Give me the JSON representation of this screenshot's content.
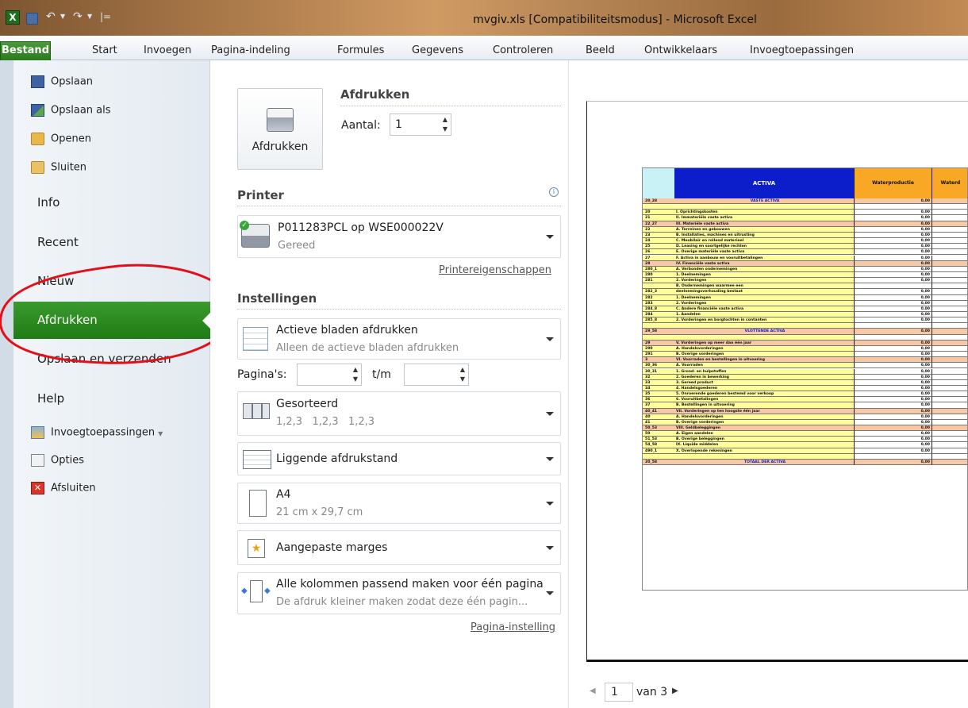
{
  "window": {
    "title": "mvgiv.xls [Compatibiliteitsmodus] - Microsoft Excel"
  },
  "ribbon": {
    "file_tab": "Bestand",
    "tabs": [
      "Start",
      "Invoegen",
      "Pagina-indeling",
      "Formules",
      "Gegevens",
      "Controleren",
      "Beeld",
      "Ontwikkelaars",
      "Invoegtoepassingen"
    ]
  },
  "backstage": {
    "items": {
      "save": "Opslaan",
      "save_as": "Opslaan als",
      "open": "Openen",
      "close": "Sluiten",
      "info": "Info",
      "recent": "Recent",
      "new": "Nieuw",
      "print": "Afdrukken",
      "save_send": "Opslaan en verzenden",
      "help": "Help",
      "addins": "Invoegtoepassingen",
      "options": "Opties",
      "exit": "Afsluiten"
    }
  },
  "print": {
    "heading": "Afdrukken",
    "button_label": "Afdrukken",
    "copies_label": "Aantal:",
    "copies_value": "1",
    "printer_heading": "Printer",
    "printer_name": "P011283PCL op WSE000022V",
    "printer_status": "Gereed",
    "printer_props_link": "Printereigenschappen",
    "settings_heading": "Instellingen",
    "settings": [
      {
        "title": "Actieve bladen afdrukken",
        "sub": "Alleen de actieve bladen afdrukken"
      },
      {
        "title": "Gesorteerd",
        "sub": "1,2,3   1,2,3   1,2,3"
      },
      {
        "title": "Liggende afdrukstand",
        "sub": ""
      },
      {
        "title": "A4",
        "sub": "21 cm x 29,7 cm"
      },
      {
        "title": "Aangepaste marges",
        "sub": ""
      },
      {
        "title": "Alle kolommen passend maken voor één pagina",
        "sub": "De afdruk kleiner maken zodat deze één pagin..."
      }
    ],
    "pages_label": "Pagina's:",
    "pages_to_label": "t/m",
    "page_setup_link": "Pagina-instelling"
  },
  "preview": {
    "header": {
      "code": "",
      "title": "ACTIVA",
      "col1": "Waterproductie",
      "col2": "Waterd"
    },
    "rows": [
      {
        "code": "20_28",
        "label": "VASTE ACTIVA",
        "value": "0,00",
        "hl": true,
        "tot": true
      },
      {
        "code": "",
        "label": "",
        "value": "",
        "hl": false,
        "tot": false
      },
      {
        "code": "20",
        "label": "I. Oprichtingskosten",
        "value": "0,00",
        "hl": false,
        "tot": false
      },
      {
        "code": "21",
        "label": "II. Immateriële vaste activa",
        "value": "0,00",
        "hl": false,
        "tot": false
      },
      {
        "code": "22_27",
        "label": "III. Materiële vaste activa",
        "value": "0,00",
        "hl": true,
        "tot": false
      },
      {
        "code": "22",
        "label": "A. Terreinen en gebouwen",
        "value": "0,00",
        "hl": false,
        "tot": false
      },
      {
        "code": "23",
        "label": "B. Installaties, machines en uitrusting",
        "value": "0,00",
        "hl": false,
        "tot": false
      },
      {
        "code": "24",
        "label": "C. Meubilair en rollend materieel",
        "value": "0,00",
        "hl": false,
        "tot": false
      },
      {
        "code": "25",
        "label": "D. Leasing en soortgelijke rechten",
        "value": "0,00",
        "hl": false,
        "tot": false
      },
      {
        "code": "26",
        "label": "E. Overige materiële vaste activa",
        "value": "0,00",
        "hl": false,
        "tot": false
      },
      {
        "code": "27",
        "label": "F. Activa in aanbouw en vooruitbetalingen",
        "value": "0,00",
        "hl": false,
        "tot": false
      },
      {
        "code": "28",
        "label": "IV. Financiële vaste activa",
        "value": "0,00",
        "hl": true,
        "tot": false
      },
      {
        "code": "280_1",
        "label": "A. Verbonden ondernemingen",
        "value": "0,00",
        "hl": false,
        "tot": false
      },
      {
        "code": "280",
        "label": "1. Deelnemingen",
        "value": "0,00",
        "hl": false,
        "tot": false
      },
      {
        "code": "281",
        "label": "2. Vorderingen",
        "value": "0,00",
        "hl": false,
        "tot": false
      },
      {
        "code": "",
        "label": "B. Ondernemingen waarmee een",
        "value": "",
        "hl": false,
        "tot": false
      },
      {
        "code": "282_3",
        "label": "deelnemingsverhouding bestaat",
        "value": "0,00",
        "hl": false,
        "tot": false
      },
      {
        "code": "282",
        "label": "1. Deelnemingen",
        "value": "0,00",
        "hl": false,
        "tot": false
      },
      {
        "code": "283",
        "label": "2. Vorderingen",
        "value": "0,00",
        "hl": false,
        "tot": false
      },
      {
        "code": "284_8",
        "label": "C. Andere financiële vaste activa",
        "value": "0,00",
        "hl": false,
        "tot": false
      },
      {
        "code": "284",
        "label": "1. Aandelen",
        "value": "0,00",
        "hl": false,
        "tot": false
      },
      {
        "code": "285_8",
        "label": "2. Vorderingen en borgtochten in contanten",
        "value": "0,00",
        "hl": false,
        "tot": false
      },
      {
        "code": "",
        "label": "",
        "value": "",
        "hl": false,
        "tot": false
      },
      {
        "code": "29_58",
        "label": "VLOTTENDE ACTIVA",
        "value": "0,00",
        "hl": true,
        "tot": true
      },
      {
        "code": "",
        "label": "",
        "value": "",
        "hl": false,
        "tot": false
      },
      {
        "code": "29",
        "label": "V. Vorderingen op meer dan één jaar",
        "value": "0,00",
        "hl": true,
        "tot": false
      },
      {
        "code": "290",
        "label": "A. Handelsvorderingen",
        "value": "0,00",
        "hl": false,
        "tot": false
      },
      {
        "code": "291",
        "label": "B. Overige vorderingen",
        "value": "0,00",
        "hl": false,
        "tot": false
      },
      {
        "code": "3",
        "label": "VI. Voorraden en bestellingen in uitvoering",
        "value": "0,00",
        "hl": true,
        "tot": false
      },
      {
        "code": "30_36",
        "label": "A. Voorraden",
        "value": "0,00",
        "hl": false,
        "tot": false
      },
      {
        "code": "30_31",
        "label": "1. Grond- en hulpstoffen",
        "value": "0,00",
        "hl": false,
        "tot": false
      },
      {
        "code": "32",
        "label": "2. Goederen in bewerking",
        "value": "0,00",
        "hl": false,
        "tot": false
      },
      {
        "code": "33",
        "label": "3. Gereed product",
        "value": "0,00",
        "hl": false,
        "tot": false
      },
      {
        "code": "34",
        "label": "4. Handelsgoederen",
        "value": "0,00",
        "hl": false,
        "tot": false
      },
      {
        "code": "35",
        "label": "5. Onroerende goederen bestemd voor verkoop",
        "value": "0,00",
        "hl": false,
        "tot": false
      },
      {
        "code": "36",
        "label": "6. Vooruitbetalingen",
        "value": "0,00",
        "hl": false,
        "tot": false
      },
      {
        "code": "37",
        "label": "B. Bestellingen in uitvoering",
        "value": "0,00",
        "hl": false,
        "tot": false
      },
      {
        "code": "40_41",
        "label": "VII. Vorderingen op ten hoogste één jaar",
        "value": "0,00",
        "hl": true,
        "tot": false
      },
      {
        "code": "40",
        "label": "A. Handelsvorderingen",
        "value": "0,00",
        "hl": false,
        "tot": false
      },
      {
        "code": "41",
        "label": "B. Overige vorderingen",
        "value": "0,00",
        "hl": false,
        "tot": false
      },
      {
        "code": "50_53",
        "label": "VIII. Geldbeleggingen",
        "value": "0,00",
        "hl": true,
        "tot": false
      },
      {
        "code": "50",
        "label": "A. Eigen aandelen",
        "value": "0,00",
        "hl": false,
        "tot": false
      },
      {
        "code": "51_53",
        "label": "B. Overige beleggingen",
        "value": "0,00",
        "hl": false,
        "tot": false
      },
      {
        "code": "54_58",
        "label": "IX. Liquide middelen",
        "value": "0,00",
        "hl": false,
        "tot": false
      },
      {
        "code": "490_1",
        "label": "X. Overlopende rekeningen",
        "value": "0,00",
        "hl": false,
        "tot": false
      },
      {
        "code": "",
        "label": "",
        "value": "",
        "hl": false,
        "tot": false
      },
      {
        "code": "20_58",
        "label": "TOTAAL DER ACTIVA",
        "value": "0,00",
        "hl": true,
        "tot": true
      }
    ],
    "page_current": "1",
    "page_total_label": "van 3"
  },
  "colors": {
    "file_tab": "#2b7a1f",
    "active_nav": "#2a8c20",
    "annotation": "#e2101a",
    "highlight_row": "#f8c7a4",
    "label_fill": "#fffe9b",
    "header_blue": "#0b1ec9",
    "header_orange": "#f9a825"
  }
}
